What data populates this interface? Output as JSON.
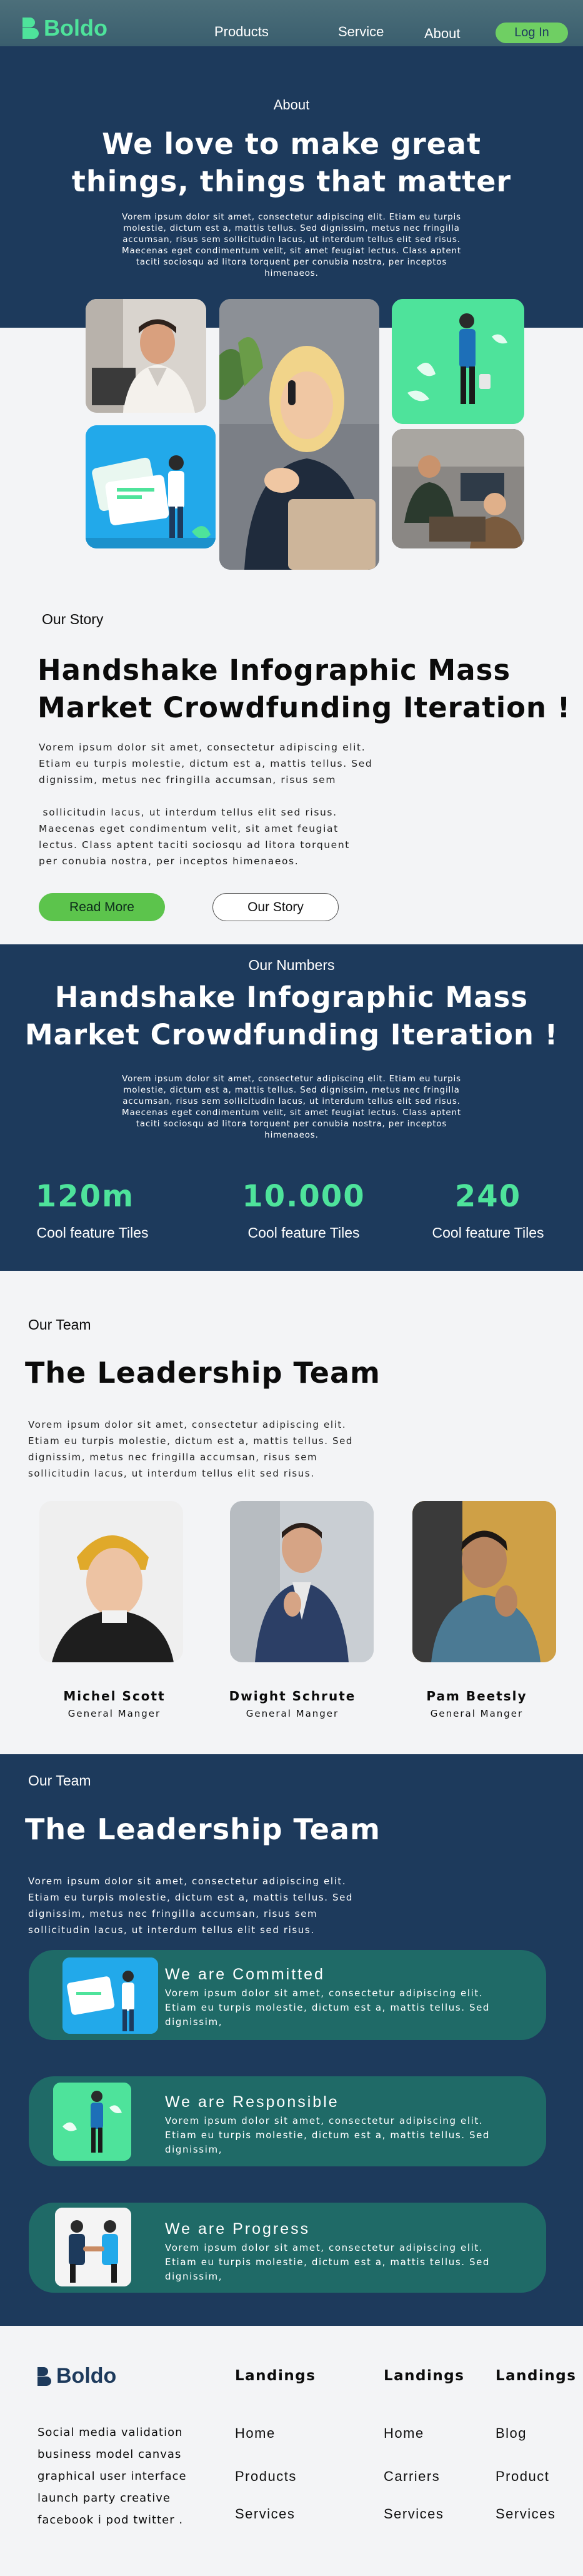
{
  "nav": {
    "brand": "Boldo",
    "links": [
      "Products",
      "Service",
      "About"
    ],
    "login": "Log In"
  },
  "hero": {
    "eyebrow": "About",
    "title_line1": "We love to make great",
    "title_line2": "things,  things that matter",
    "desc": [
      "Vorem ipsum dolor sit amet, consectetur adipiscing elit. Etiam eu turpis",
      "molestie, dictum est a, mattis tellus. Sed dignissim, metus nec fringilla",
      "accumsan, risus sem sollicitudin lacus, ut interdum tellus elit sed risus.",
      "Maecenas eget condimentum velit, sit amet feugiat lectus. Class aptent",
      "taciti sociosqu ad litora torquent per conubia nostra, per inceptos",
      "himenaeos."
    ]
  },
  "story": {
    "eyebrow": "Our Story",
    "title_line1": "Handshake Infographic Mass",
    "title_line2": "Market Crowdfunding Iteration !",
    "para": [
      "Vorem ipsum dolor sit amet, consectetur adipiscing elit.",
      "Etiam eu turpis molestie, dictum est a, mattis tellus. Sed",
      "dignissim, metus nec fringilla accumsan, risus sem",
      "",
      " sollicitudin lacus, ut interdum tellus elit sed risus.",
      "Maecenas eget condimentum velit, sit amet feugiat",
      "lectus. Class aptent taciti sociosqu ad litora torquent",
      "per conubia nostra, per inceptos himenaeos."
    ],
    "read_more": "Read More",
    "our_story": "Our Story"
  },
  "numbers": {
    "eyebrow": "Our Numbers",
    "title_line1": "Handshake Infographic Mass",
    "title_line2": "Market Crowdfunding Iteration !",
    "desc": [
      "Vorem ipsum dolor sit amet, consectetur adipiscing elit. Etiam eu turpis",
      "molestie, dictum est a, mattis tellus. Sed dignissim, metus nec fringilla",
      "accumsan, risus sem sollicitudin lacus, ut interdum tellus elit sed risus.",
      "Maecenas eget condimentum velit, sit amet feugiat lectus. Class aptent",
      "taciti sociosqu ad litora torquent per conubia nostra, per inceptos",
      "himenaeos."
    ],
    "stats": [
      {
        "value": "120m",
        "label": "Cool feature Tiles"
      },
      {
        "value": "10.000",
        "label": "Cool feature Tiles"
      },
      {
        "value": "240",
        "label": "Cool feature Tiles"
      }
    ],
    "accent": "#4ee39b"
  },
  "leadership": {
    "eyebrow": "Our Team",
    "title": "The Leadership Team",
    "desc": [
      "Vorem ipsum dolor sit amet, consectetur adipiscing elit.",
      "Etiam eu turpis molestie, dictum est a, mattis tellus. Sed",
      "dignissim, metus nec fringilla accumsan, risus sem",
      "sollicitudin lacus, ut interdum tellus elit sed risus."
    ],
    "members": [
      {
        "name": "Michel Scott",
        "role": "General Manger"
      },
      {
        "name": "Dwight Schrute",
        "role": "General Manger"
      },
      {
        "name": "Pam Beetsly",
        "role": "General Manger"
      }
    ]
  },
  "team": {
    "eyebrow": "Our Team",
    "title": "The Leadership Team",
    "desc": [
      "Vorem ipsum dolor sit amet, consectetur adipiscing elit.",
      "Etiam eu turpis molestie, dictum est a, mattis tellus. Sed",
      "dignissim, metus nec fringilla accumsan, risus sem",
      "sollicitudin lacus, ut interdum tellus elit sed risus."
    ],
    "values": [
      {
        "title": "We are Committed",
        "text": [
          "Vorem ipsum dolor sit amet, consectetur adipiscing elit.",
          "Etiam eu turpis molestie, dictum est a, mattis tellus. Sed",
          "dignissim,"
        ]
      },
      {
        "title": "We are Responsible",
        "text": [
          "Vorem ipsum dolor sit amet, consectetur adipiscing elit.",
          "Etiam eu turpis molestie, dictum est a, mattis tellus. Sed",
          "dignissim,"
        ]
      },
      {
        "title": "We are Progress",
        "text": [
          "Vorem ipsum dolor sit amet, consectetur adipiscing elit.",
          "Etiam eu turpis molestie, dictum est a, mattis tellus. Sed",
          "dignissim,"
        ]
      }
    ]
  },
  "footer": {
    "brand": "Boldo",
    "desc": [
      "Social media validation",
      "business model canvas",
      "graphical user interface",
      "launch party creative",
      "facebook i pod twitter ."
    ],
    "columns": [
      {
        "heading": "Landings",
        "links": [
          "Home",
          "Products",
          "Services"
        ]
      },
      {
        "heading": "Landings",
        "links": [
          "Home",
          "Carriers",
          "Services"
        ]
      },
      {
        "heading": "Landings",
        "links": [
          "Blog",
          "Product",
          "Services"
        ]
      }
    ]
  },
  "colors": {
    "navy": "#1d3a5c",
    "green_button": "#5cc44c",
    "teal_pill": "#1f6a67",
    "brand_green": "#4ee39b"
  }
}
